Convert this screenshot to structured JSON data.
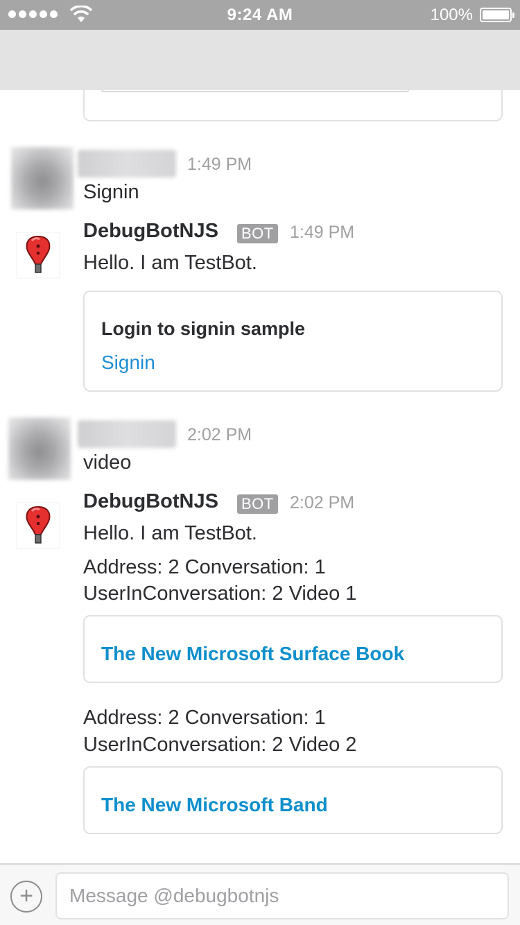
{
  "status_bar": {
    "time": "9:24 AM",
    "battery": "100%",
    "icons": [
      "signal-icon",
      "wifi-icon",
      "battery-icon"
    ]
  },
  "messages": [
    {
      "type": "user",
      "time": "1:49 PM",
      "text": "Signin"
    },
    {
      "type": "bot",
      "sender": "DebugBotNJS",
      "tag": "BOT",
      "time": "1:49 PM",
      "text": "Hello. I am TestBot.",
      "card": {
        "title": "Login to signin sample",
        "button": "Signin"
      }
    },
    {
      "type": "user",
      "time": "2:02 PM",
      "text": "video"
    },
    {
      "type": "bot",
      "sender": "DebugBotNJS",
      "tag": "BOT",
      "time": "2:02 PM",
      "text": "Hello. I am TestBot.",
      "attachments": [
        {
          "line1": "Address: 2 Conversation: 1",
          "line2": "UserInConversation: 2 Video 1",
          "link": "The New Microsoft Surface Book"
        },
        {
          "line1": "Address: 2 Conversation: 1",
          "line2": "UserInConversation: 2 Video 2",
          "link": "The New Microsoft Band"
        }
      ]
    }
  ],
  "composer": {
    "placeholder": "Message @debugbotnjs",
    "add_icon": "plus-icon"
  },
  "colors": {
    "status_bar": "#a6a6a6",
    "nav_bar": "#e3e3e3",
    "link": "#1f8fd2",
    "muted": "#a0a0a2"
  }
}
